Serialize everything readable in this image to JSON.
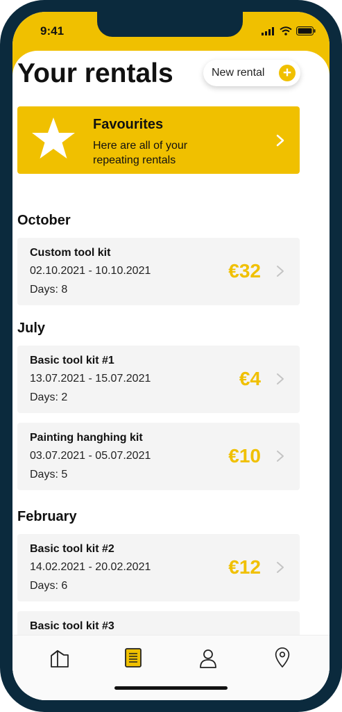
{
  "status_bar": {
    "time": "9:41"
  },
  "header": {
    "title": "Your rentals",
    "new_rental_label": "New rental"
  },
  "favourites": {
    "title": "Favourites",
    "subtitle": "Here are all of your repeating rentals"
  },
  "groups": [
    {
      "month": "October",
      "rentals": [
        {
          "name": "Custom tool kit",
          "dates": "02.10.2021 - 10.10.2021",
          "days": "Days: 8",
          "price": "€32"
        }
      ]
    },
    {
      "month": "July",
      "rentals": [
        {
          "name": "Basic tool kit #1",
          "dates": "13.07.2021 - 15.07.2021",
          "days": "Days: 2",
          "price": "€4"
        },
        {
          "name": "Painting hanghing kit",
          "dates": "03.07.2021 - 05.07.2021",
          "days": "Days: 5",
          "price": "€10"
        }
      ]
    },
    {
      "month": "February",
      "rentals": [
        {
          "name": "Basic tool kit #2",
          "dates": "14.02.2021 - 20.02.2021",
          "days": "Days: 6",
          "price": "€12"
        },
        {
          "name": "Basic tool kit #3"
        }
      ]
    }
  ],
  "tab_bar": {
    "tabs": [
      {
        "icon": "home-icon",
        "active": false
      },
      {
        "icon": "document-icon",
        "active": true
      },
      {
        "icon": "profile-icon",
        "active": false
      },
      {
        "icon": "location-pin-icon",
        "active": false
      }
    ]
  },
  "colors": {
    "accent": "#f0c000",
    "frame": "#0b2a3d",
    "card": "#f4f4f4"
  }
}
